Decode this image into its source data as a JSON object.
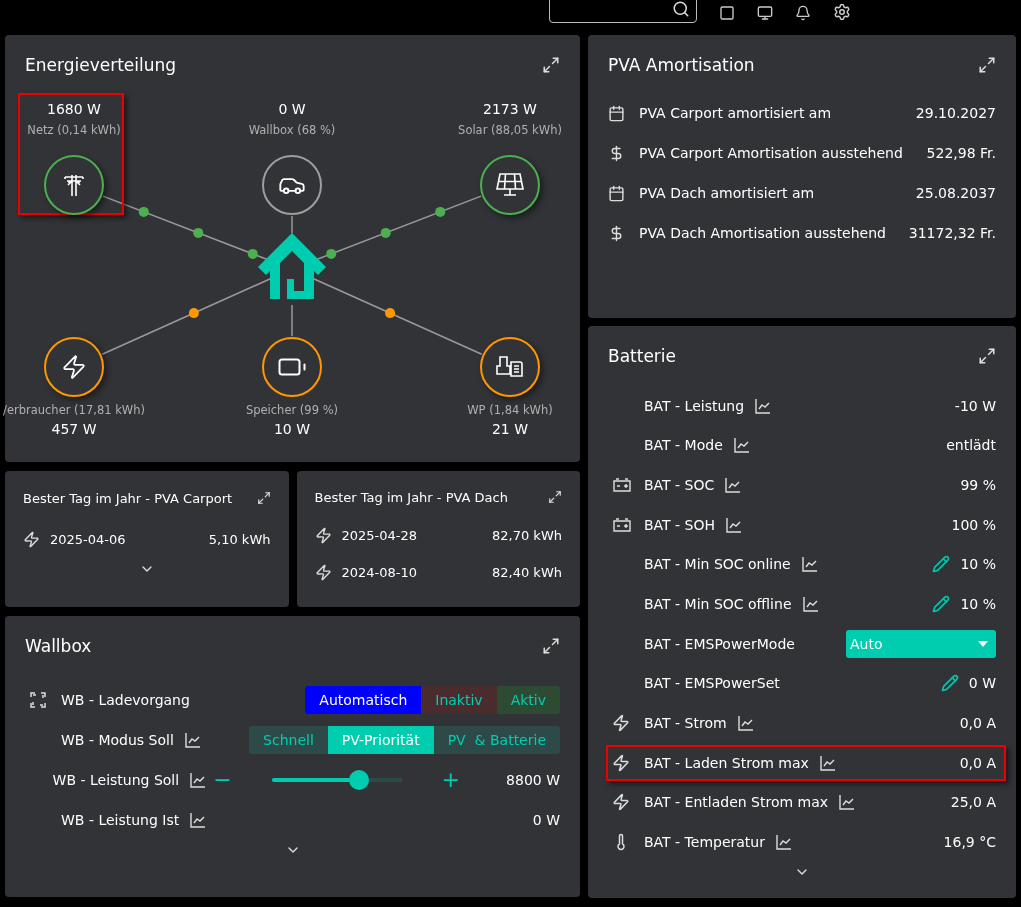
{
  "energy": {
    "title": "Energieverteilung",
    "nodes": [
      {
        "power": "1680 W",
        "label": "Netz (0,14 kWh)",
        "color": "#4caf50",
        "flow": true,
        "highlighted": true
      },
      {
        "power": "0 W",
        "label": "Wallbox (68 %)",
        "color": "#9e9e9e",
        "flow": false,
        "highlighted": false
      },
      {
        "power": "2173 W",
        "label": "Solar (88,05 kWh)",
        "color": "#4caf50",
        "flow": true,
        "highlighted": false
      },
      {
        "power": "457 W",
        "label": "/erbraucher (17,81 kWh)",
        "color": "#ff9800",
        "flow": true,
        "highlighted": false
      },
      {
        "power": "10 W",
        "label": "Speicher (99 %)",
        "color": "#ff9800",
        "flow": false,
        "highlighted": false
      },
      {
        "power": "21 W",
        "label": "WP (1,84 kWh)",
        "color": "#ff9800",
        "flow": true,
        "highlighted": false
      }
    ]
  },
  "best_days": [
    {
      "title": "Bester Tag im Jahr - PVA Carport",
      "more": true,
      "rows": [
        {
          "date": "2025-04-06",
          "value": "5,10 kWh"
        }
      ]
    },
    {
      "title": "Bester Tag im Jahr - PVA Dach",
      "more": false,
      "rows": [
        {
          "date": "2025-04-28",
          "value": "82,70 kWh"
        },
        {
          "date": "2024-08-10",
          "value": "82,40 kWh"
        }
      ]
    }
  ],
  "wallbox": {
    "title": "Wallbox",
    "more": true,
    "rows": [
      {
        "kind": "toggle",
        "label": "WB - Ladevorgang",
        "chart": false,
        "options": [
          {
            "label": "Automatisch",
            "selected": true,
            "color": "#0000ff"
          },
          {
            "label": "Inaktiv",
            "selected": false,
            "color": "#4a2c2f"
          },
          {
            "label": "Aktiv",
            "selected": false,
            "color": "#2d4a33"
          }
        ]
      },
      {
        "kind": "segmented",
        "label": "WB - Modus Soll",
        "chart": true,
        "options": [
          {
            "label": "Schnell",
            "selected": false
          },
          {
            "label": "PV-Priorität",
            "selected": true
          },
          {
            "label": "PV  & Batterie",
            "selected": false
          }
        ]
      },
      {
        "kind": "slider",
        "label": "WB - Leistung Soll",
        "chart": true,
        "minus": "−",
        "plus": "+",
        "level": 0.67,
        "value": "8800 W"
      },
      {
        "kind": "value",
        "label": "WB - Leistung Ist",
        "chart": true,
        "value": "0 W"
      }
    ]
  },
  "amortisation": {
    "title": "PVA Amortisation",
    "rows": [
      {
        "kind": "date",
        "label": "PVA Carport amortisiert am",
        "value": "29.10.2027"
      },
      {
        "kind": "amount",
        "label": "PVA Carport Amortisation ausstehend",
        "value": "522,98 Fr."
      },
      {
        "kind": "date",
        "label": "PVA Dach amortisiert am",
        "value": "25.08.2037"
      },
      {
        "kind": "amount",
        "label": "PVA Dach Amortisation ausstehend",
        "value": "31172,32 Fr."
      }
    ]
  },
  "battery": {
    "title": "Batterie",
    "more": true,
    "rows": [
      {
        "kind": "plain",
        "label": "BAT - Leistung",
        "chart": true,
        "editable": false,
        "value": "-10 W",
        "highlighted": false
      },
      {
        "kind": "plain",
        "label": "BAT - Mode",
        "chart": true,
        "editable": false,
        "value": "entlädt",
        "highlighted": false
      },
      {
        "kind": "charge",
        "label": "BAT - SOC",
        "chart": true,
        "editable": false,
        "value": "99 %",
        "highlighted": false
      },
      {
        "kind": "charge",
        "label": "BAT - SOH",
        "chart": true,
        "editable": false,
        "value": "100 %",
        "highlighted": false
      },
      {
        "kind": "plain",
        "label": "BAT - Min SOC online",
        "chart": true,
        "editable": true,
        "value": "10 %",
        "highlighted": false
      },
      {
        "kind": "plain",
        "label": "BAT - Min SOC offline",
        "chart": true,
        "editable": true,
        "value": "10 %",
        "highlighted": false
      },
      {
        "kind": "select",
        "label": "BAT - EMSPowerMode",
        "chart": false,
        "value": "Auto",
        "highlighted": false
      },
      {
        "kind": "plain",
        "label": "BAT - EMSPowerSet",
        "chart": false,
        "editable": true,
        "value": "0 W",
        "highlighted": false
      },
      {
        "kind": "current",
        "label": "BAT - Strom",
        "chart": true,
        "editable": false,
        "value": "0,0 A",
        "highlighted": false
      },
      {
        "kind": "current",
        "label": "BAT - Laden Strom max",
        "chart": true,
        "editable": false,
        "value": "0,0 A",
        "highlighted": true
      },
      {
        "kind": "current",
        "label": "BAT - Entladen Strom max",
        "chart": true,
        "editable": false,
        "value": "25,0 A",
        "highlighted": false
      },
      {
        "kind": "temperature",
        "label": "BAT - Temperatur",
        "chart": true,
        "editable": false,
        "value": "16,9 °C",
        "highlighted": false
      }
    ]
  }
}
